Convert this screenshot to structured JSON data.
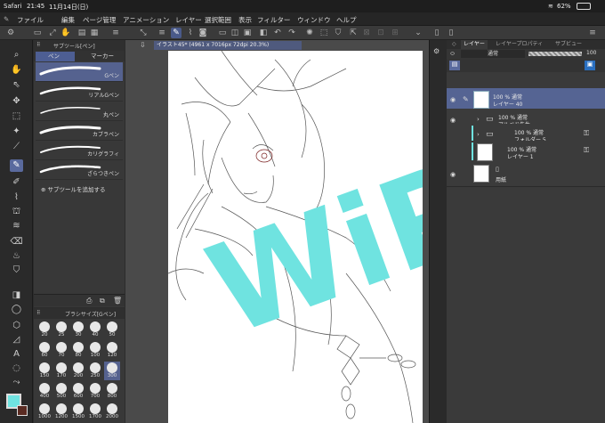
{
  "status": {
    "carrier": "Safari",
    "time": "21:45",
    "date": "11月14日(日)",
    "battery": "62%"
  },
  "menu": [
    "ファイル",
    "編集",
    "ページ管理",
    "アニメーション",
    "レイヤー",
    "選択範囲",
    "表示",
    "フィルター",
    "ウィンドウ",
    "ヘルプ"
  ],
  "subtool_panel": {
    "title": "サブツール[ペン]",
    "tabs": [
      "ペン",
      "マーカー"
    ],
    "brushes": [
      {
        "label": "Gペン",
        "selected": true
      },
      {
        "label": "リアルGペン",
        "selected": false
      },
      {
        "label": "丸ペン",
        "selected": false
      },
      {
        "label": "カブラペン",
        "selected": false
      },
      {
        "label": "カリグラフィ",
        "selected": false
      },
      {
        "label": "ざらつきペン",
        "selected": false
      }
    ],
    "add_label": "サブツールを追加する"
  },
  "brush_size": {
    "title": "ブラシサイズ[Gペン]",
    "sizes": [
      "20",
      "25",
      "30",
      "40",
      "50",
      "60",
      "70",
      "80",
      "100",
      "120",
      "150",
      "170",
      "200",
      "250",
      "300",
      "400",
      "500",
      "600",
      "700",
      "800",
      "1000",
      "1200",
      "1500",
      "1700",
      "2000"
    ],
    "selected": "300"
  },
  "canvas": {
    "tab_title": "イラスト45* (4961 x 7016px 72dpi 20.3%)",
    "overlay_text": "WiP",
    "overlay_color": "#6fe3e0"
  },
  "layer_panel": {
    "tabs": [
      "レイヤー",
      "レイヤープロパティ",
      "サブビュー"
    ],
    "blend_mode": "通常",
    "opacity": "100",
    "layers": [
      {
        "line1": "100 % 通常",
        "line2": "レイヤー 40",
        "selected": true
      },
      {
        "line1": "100 % 通常",
        "line2": "アルベド先生",
        "selected": false
      },
      {
        "line1": "100 % 通常",
        "line2": "フォルダー 5",
        "selected": false
      },
      {
        "line1": "100 % 通常",
        "line2": "レイヤー 1",
        "selected": false
      },
      {
        "line1": "",
        "line2": "用紙",
        "selected": false
      }
    ]
  },
  "colors": {
    "accent": "#55628f",
    "main_color": "#6fe3e0"
  }
}
